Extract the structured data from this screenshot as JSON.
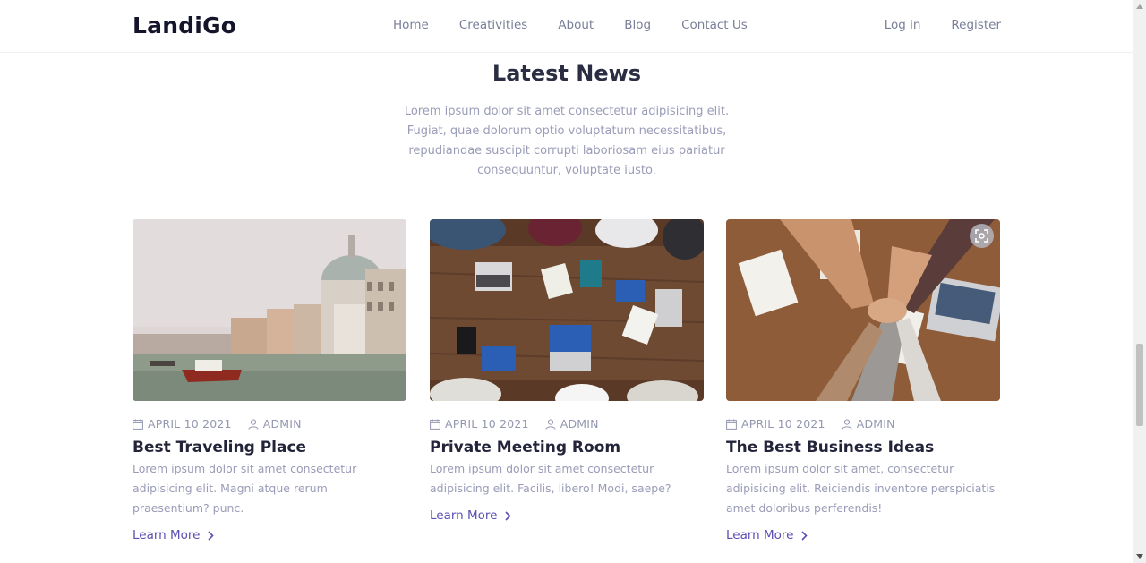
{
  "brand": {
    "name": "LandiGo"
  },
  "nav": [
    {
      "label": "Home"
    },
    {
      "label": "Creativities"
    },
    {
      "label": "About"
    },
    {
      "label": "Blog"
    },
    {
      "label": "Contact Us"
    }
  ],
  "auth": {
    "login": "Log in",
    "register": "Register"
  },
  "section": {
    "title": "Latest News",
    "intro": "Lorem ipsum dolor sit amet consectetur adipisicing elit. Fugiat, quae dolorum optio voluptatum necessitatibus, repudiandae suscipit corrupti laboriosam eius pariatur consequuntur, voluptate iusto."
  },
  "posts": [
    {
      "date": "APRIL 10 2021",
      "author": "ADMIN",
      "title": "Best Traveling Place",
      "excerpt": "Lorem ipsum dolor sit amet consectetur adipisicing elit. Magni atque rerum praesentium? punc.",
      "cta": "Learn More",
      "image": "venice-canal-photo"
    },
    {
      "date": "APRIL 10 2021",
      "author": "ADMIN",
      "title": "Private Meeting Room",
      "excerpt": "Lorem ipsum dolor sit amet consectetur adipisicing elit. Facilis, libero! Modi, saepe?",
      "cta": "Learn More",
      "image": "meeting-table-photo"
    },
    {
      "date": "APRIL 10 2021",
      "author": "ADMIN",
      "title": "The Best Business Ideas",
      "excerpt": "Lorem ipsum dolor sit amet, consectetur adipisicing elit. Reiciendis inventore perspiciatis amet doloribus perferendis!",
      "cta": "Learn More",
      "image": "team-hands-photo"
    }
  ],
  "colors": {
    "accent": "#5b4fb3",
    "heading": "#2b2d42",
    "muted": "#9a9cb8"
  }
}
